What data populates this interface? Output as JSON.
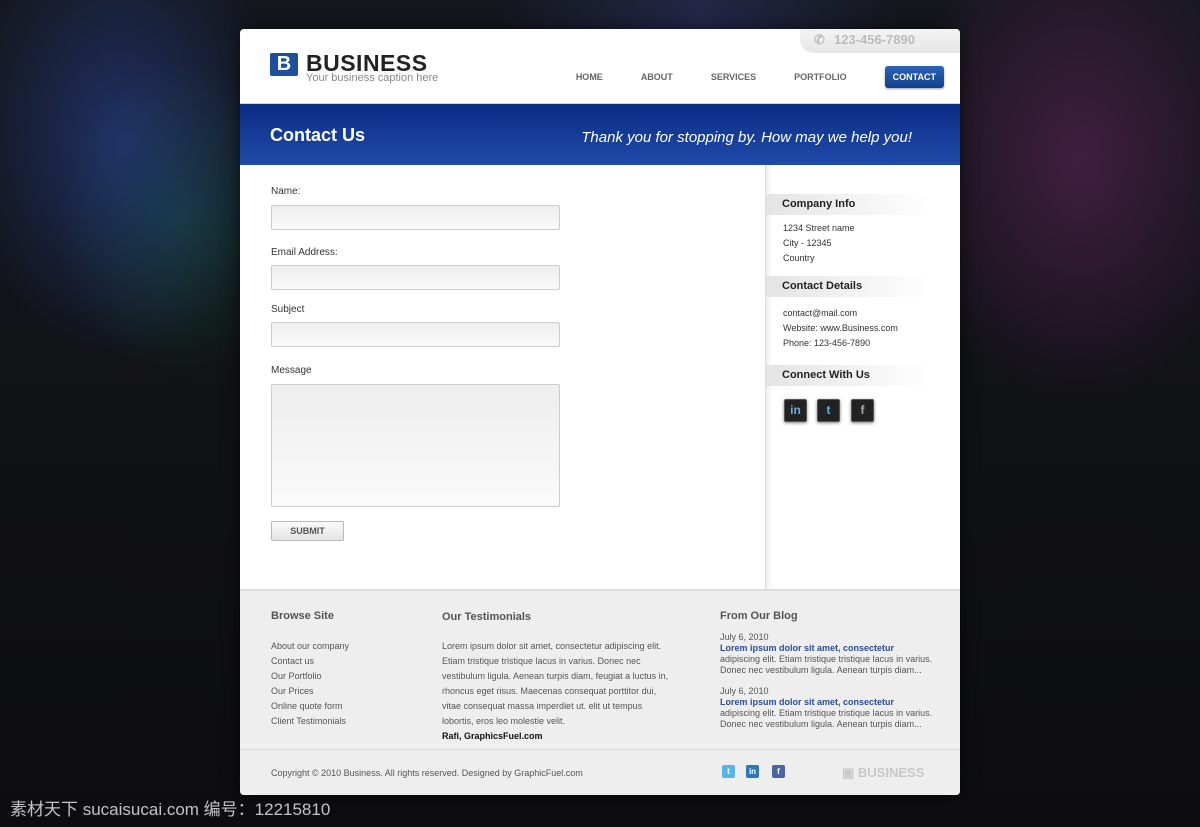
{
  "header": {
    "logo_letter": "B",
    "logo_name": "BUSINESS",
    "caption": "Your business caption here",
    "phone": "123-456-7890",
    "nav": [
      {
        "label": "HOME"
      },
      {
        "label": "ABOUT"
      },
      {
        "label": "SERVICES"
      },
      {
        "label": "PORTFOLIO"
      },
      {
        "label": "CONTACT",
        "active": true
      }
    ]
  },
  "banner": {
    "title": "Contact Us",
    "tagline": "Thank you for stopping by. How may we help you!"
  },
  "form": {
    "name_label": "Name:",
    "email_label": "Email Address:",
    "subject_label": "Subject",
    "message_label": "Message",
    "name_value": "",
    "email_value": "",
    "subject_value": "",
    "message_value": "",
    "submit": "SUBMIT"
  },
  "sidebar": {
    "company_info": {
      "title": "Company Info",
      "lines": [
        "1234 Street name",
        "City - 12345",
        "Country"
      ]
    },
    "contact_details": {
      "title": "Contact Details",
      "lines": [
        "contact@mail.com",
        "Website: www.Business.com",
        "Phone: 123-456-7890"
      ]
    },
    "connect": {
      "title": "Connect With Us",
      "icons": [
        "linkedin-icon",
        "twitter-icon",
        "facebook-icon"
      ]
    }
  },
  "footer": {
    "browse": {
      "title": "Browse Site",
      "links": [
        "About our company",
        "Contact us",
        "Our Portfolio",
        "Our Prices",
        "Online quote form",
        "Client Testimonials"
      ]
    },
    "testimonials": {
      "title": "Our Testimonials",
      "lines": [
        "Lorem ipsum dolor sit amet, consectetur adipiscing elit.",
        "Etiam tristique tristique lacus in varius. Donec nec",
        "vestibulum ligula. Aenean turpis diam, feugiat a luctus in,",
        "rhoncus eget risus. Maecenas consequat porttitor dui,",
        "vitae consequat massa imperdiet ut. elit ut tempus",
        "lobortis, eros leo molestie velit."
      ],
      "author": "Rafi, GraphicsFuel.com"
    },
    "blog": {
      "title": "From Our Blog",
      "posts": [
        {
          "date": "July 6, 2010",
          "title": "Lorem ipsum dolor sit amet, consectetur",
          "l1": "adipiscing elit. Etiam tristique tristique lacus in varius.",
          "l2": "Donec nec vestibulum ligula. Aenean turpis diam..."
        },
        {
          "date": "July 6, 2010",
          "title": "Lorem ipsum dolor sit amet, consectetur",
          "l1": "adipiscing elit. Etiam tristique tristique lacus in varius.",
          "l2": "Donec nec vestibulum ligula. Aenean turpis diam..."
        }
      ]
    },
    "copyright": "Copyright © 2010 Business. All rights reserved. Designed by GraphicFuel.com",
    "logo": "BUSINESS"
  },
  "watermark": "素材天下 sucaisucai.com  编号：12215810",
  "colors": {
    "brand": "#1d4f9c",
    "banner": "#0a2d86",
    "link": "#2b4d99"
  }
}
